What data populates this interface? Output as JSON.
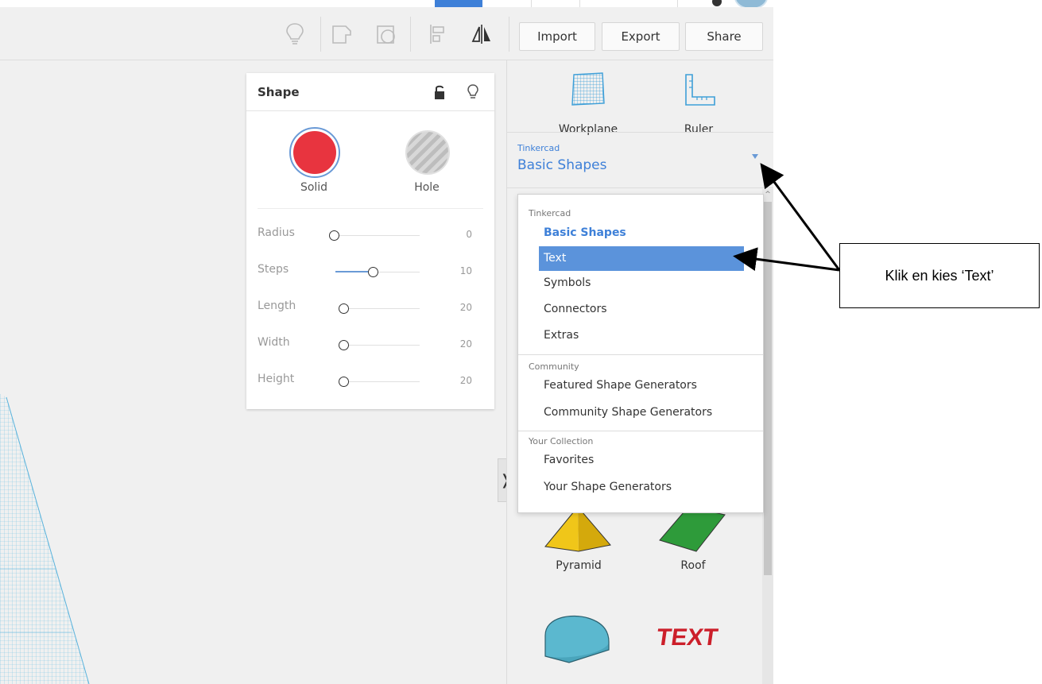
{
  "toolbar": {
    "import_label": "Import",
    "export_label": "Export",
    "share_label": "Share",
    "icons": [
      "lightbulb-icon",
      "group-icon",
      "ungroup-icon",
      "align-icon",
      "mirror-icon"
    ]
  },
  "shape_panel": {
    "title": "Shape",
    "solid_label": "Solid",
    "hole_label": "Hole",
    "solid_color": "#e8343f",
    "params": [
      {
        "label": "Radius",
        "value": "0"
      },
      {
        "label": "Steps",
        "value": "10"
      },
      {
        "label": "Length",
        "value": "20"
      },
      {
        "label": "Width",
        "value": "20"
      },
      {
        "label": "Height",
        "value": "20"
      }
    ]
  },
  "right_panel": {
    "workplane_label": "Workplane",
    "ruler_label": "Ruler",
    "library_caption": "Tinkercad",
    "library_selected": "Basic Shapes",
    "shapes": [
      {
        "label": "Pyramid",
        "color": "#f0c619"
      },
      {
        "label": "Roof",
        "color": "#2e9b3a"
      }
    ],
    "text_shape_glyph": "TEXT"
  },
  "dropdown": {
    "groups": [
      {
        "caption": "Tinkercad",
        "items": [
          "Basic Shapes",
          "Text",
          "Symbols",
          "Connectors",
          "Extras"
        ]
      },
      {
        "caption": "Community",
        "items": [
          "Featured Shape Generators",
          "Community Shape Generators"
        ]
      },
      {
        "caption": "Your Collection",
        "items": [
          "Favorites",
          "Your Shape Generators"
        ]
      }
    ],
    "selected": "Text"
  },
  "annotation": {
    "text": "Klik en kies ‘Text’"
  },
  "colors": {
    "accent": "#3e80d8",
    "highlight": "#5b93db",
    "grid": "#7fc6e4"
  }
}
